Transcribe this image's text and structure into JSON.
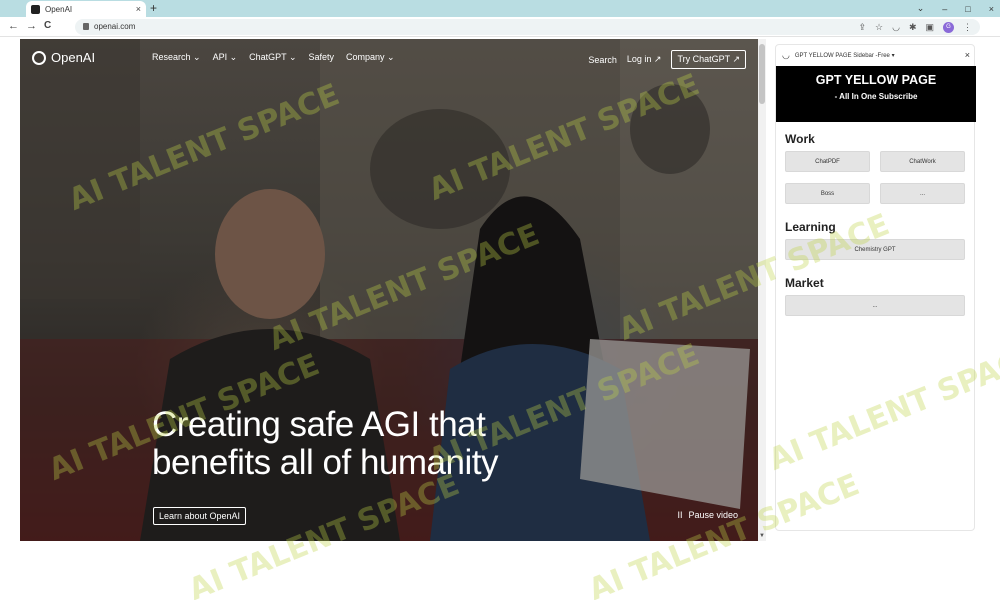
{
  "browser": {
    "tab_title": "OpenAI",
    "tab_close": "×",
    "new_tab": "+",
    "win_controls": [
      "⌄",
      "–",
      "□",
      "×"
    ],
    "back": "←",
    "forward": "→",
    "reload": "C",
    "url": "openai.com",
    "omnibox_icons": [
      "share-icon",
      "star-icon",
      "extension-sidebar-icon",
      "puzzle-icon",
      "sidebar-panel-icon",
      "profile-icon",
      "menu-icon"
    ],
    "profile_letter": "G"
  },
  "hero": {
    "logo_text": "OpenAI",
    "nav": [
      "Research ⌄",
      "API ⌄",
      "ChatGPT ⌄",
      "Safety",
      "Company ⌄"
    ],
    "search": "Search",
    "login": "Log in ↗",
    "try_button": "Try ChatGPT ↗",
    "headline": "Creating safe AGI that benefits all of humanity",
    "learn_button": "Learn about OpenAI",
    "pause_label": "Pause video",
    "pause_icon": "II"
  },
  "sidebar": {
    "header_title": "GPT YELLOW PAGE Sidebar -Free",
    "dropdown": "▾",
    "close": "×",
    "banner_title": "GPT YELLOW PAGE",
    "banner_subtitle": "- All In One Subscribe",
    "sections": [
      {
        "title": "Work",
        "buttons": [
          "ChatPDF",
          "ChatWork",
          "Boss",
          "..."
        ]
      },
      {
        "title": "Learning",
        "buttons": [
          "Chemistry GPT"
        ]
      },
      {
        "title": "Market",
        "buttons": [
          "..."
        ]
      }
    ]
  },
  "watermark": "AI TALENT SPACE"
}
